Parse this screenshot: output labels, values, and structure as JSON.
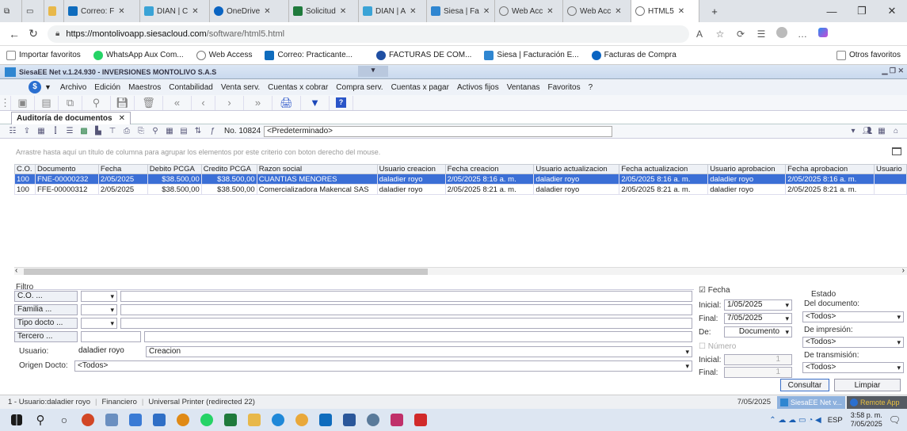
{
  "browser": {
    "tabs": [
      {
        "label": "Correo: F",
        "color": "#0f6cbd"
      },
      {
        "label": "DIAN | C",
        "color": "#3aa3d6"
      },
      {
        "label": "OneDrive",
        "color": "#0a64c2"
      },
      {
        "label": "Solicitud",
        "color": "#1f7a3c"
      },
      {
        "label": "DIAN | A",
        "color": "#3aa3d6"
      },
      {
        "label": "Siesa | Fa",
        "color": "#2f86d1"
      },
      {
        "label": "Web Acc",
        "color": "#777777"
      },
      {
        "label": "Web Acc",
        "color": "#777777"
      },
      {
        "label": "HTML5",
        "color": "#777777"
      }
    ],
    "new_tab": "+",
    "url_host": "https://montolivoapp.siesacloud.com",
    "url_path": "/software/html5.html",
    "favorites": [
      {
        "label": "Importar favoritos",
        "color": "#888888"
      },
      {
        "label": "WhatsApp Aux Com...",
        "color": "#25d366"
      },
      {
        "label": "Web Access",
        "color": "#777777"
      },
      {
        "label": "Correo: Practicante...",
        "color": "#0f6cbd"
      },
      {
        "label": "FACTURAS DE COM...",
        "color": "#1f4fa3"
      },
      {
        "label": "Siesa | Facturación E...",
        "color": "#2f86d1"
      },
      {
        "label": "Facturas de Compra",
        "color": "#0a64c2"
      }
    ],
    "other_favorites": "Otros favoritos"
  },
  "app": {
    "title": "SiesaEE Net v.1.24.930 - INVERSIONES MONTOLIVO S.A.S",
    "menu": [
      "Archivo",
      "Edición",
      "Maestros",
      "Contabilidad",
      "Venta serv.",
      "Cuentas x cobrar",
      "Compra serv.",
      "Cuentas x pagar",
      "Activos fijos",
      "Ventanas",
      "Favoritos",
      "?"
    ],
    "doc_tab": "Auditoría de documentos",
    "doc_number": "No. 10824",
    "layout": "<Predeterminado>",
    "group_hint": "Arrastre hasta aquí un título de columna para agrupar los elementos por este criterio con boton derecho del mouse."
  },
  "grid": {
    "columns": [
      "C.O.",
      "Documento",
      "Fecha",
      "Debito PCGA",
      "Credito PCGA",
      "Razon social",
      "Usuario creacion",
      "Fecha creacion",
      "Usuario actualizacion",
      "Fecha actualizacion",
      "Usuario aprobacion",
      "Fecha aprobacion",
      "Usuario"
    ],
    "rows": [
      [
        "100",
        "FNE-00000232",
        "2/05/2025",
        "$38.500,00",
        "$38.500,00",
        "CUANTIAS MENORES",
        "daladier royo",
        "2/05/2025 8:16 a. m.",
        "daladier royo",
        "2/05/2025 8:16 a. m.",
        "daladier royo",
        "2/05/2025 8:16 a. m.",
        ""
      ],
      [
        "100",
        "FFE-00000312",
        "2/05/2025",
        "$38.500,00",
        "$38.500,00",
        "Comercializadora Makencal SAS",
        "daladier royo",
        "2/05/2025 8:21 a. m.",
        "daladier royo",
        "2/05/2025 8:21 a. m.",
        "daladier royo",
        "2/05/2025 8:21 a. m.",
        ""
      ]
    ]
  },
  "filter": {
    "legend": "Filtro",
    "co": "C.O. ...",
    "familia": "Familia ...",
    "tipo": "Tipo docto ...",
    "tercero": "Tercero ...",
    "usuario_label": "Usuario:",
    "usuario_value": "daladier royo",
    "usuario_tipo": "Creacion",
    "origen_label": "Origen Docto:",
    "origen_value": "<Todos>",
    "fecha_label": "Fecha",
    "inicial_label": "Inicial:",
    "inicial_value": "1/05/2025",
    "final_label": "Final:",
    "final_value": "7/05/2025",
    "de_label": "De:",
    "de_value": "Documento",
    "numero_label": "Número",
    "num_inicial": "1",
    "num_final": "1",
    "estado_label": "Estado",
    "del_doc_label": "Del documento:",
    "del_doc_value": "<Todos>",
    "impresion_label": "De impresión:",
    "impresion_value": "<Todos>",
    "transmision_label": "De transmisión:",
    "transmision_value": "<Todos>",
    "consultar": "Consultar",
    "limpiar": "Limpiar"
  },
  "status": {
    "user": "1 - Usuario:daladier royo",
    "module": "Financiero",
    "printer": "Universal Printer (redirected 22)",
    "date": "7/05/2025",
    "app_task": "SiesaEE Net v...",
    "remote": "Remote App"
  },
  "taskbar": {
    "lang": "ESP",
    "time": "3:58 p. m.",
    "date": "7/05/2025"
  }
}
